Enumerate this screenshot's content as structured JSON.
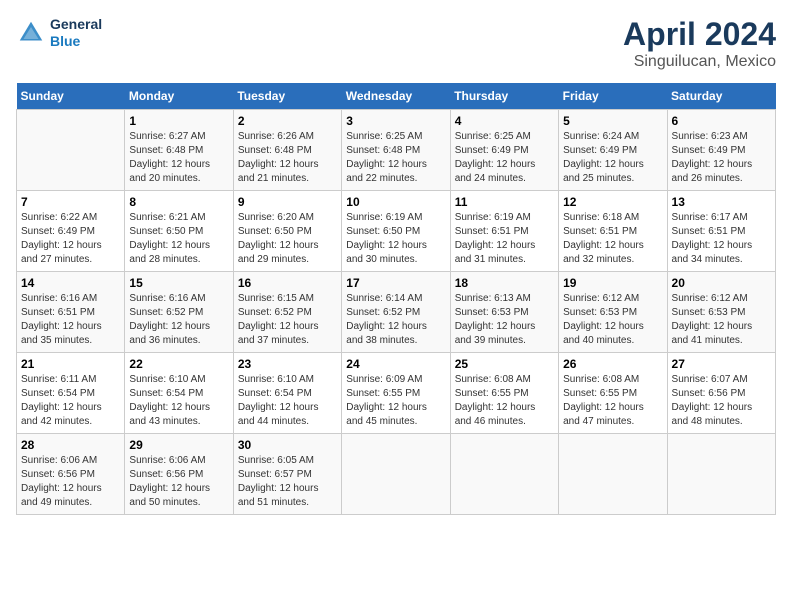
{
  "header": {
    "logo_general": "General",
    "logo_blue": "Blue",
    "title": "April 2024",
    "subtitle": "Singuilucan, Mexico"
  },
  "calendar": {
    "days_of_week": [
      "Sunday",
      "Monday",
      "Tuesday",
      "Wednesday",
      "Thursday",
      "Friday",
      "Saturday"
    ],
    "weeks": [
      [
        {
          "day": "",
          "info": ""
        },
        {
          "day": "1",
          "info": "Sunrise: 6:27 AM\nSunset: 6:48 PM\nDaylight: 12 hours\nand 20 minutes."
        },
        {
          "day": "2",
          "info": "Sunrise: 6:26 AM\nSunset: 6:48 PM\nDaylight: 12 hours\nand 21 minutes."
        },
        {
          "day": "3",
          "info": "Sunrise: 6:25 AM\nSunset: 6:48 PM\nDaylight: 12 hours\nand 22 minutes."
        },
        {
          "day": "4",
          "info": "Sunrise: 6:25 AM\nSunset: 6:49 PM\nDaylight: 12 hours\nand 24 minutes."
        },
        {
          "day": "5",
          "info": "Sunrise: 6:24 AM\nSunset: 6:49 PM\nDaylight: 12 hours\nand 25 minutes."
        },
        {
          "day": "6",
          "info": "Sunrise: 6:23 AM\nSunset: 6:49 PM\nDaylight: 12 hours\nand 26 minutes."
        }
      ],
      [
        {
          "day": "7",
          "info": "Sunrise: 6:22 AM\nSunset: 6:49 PM\nDaylight: 12 hours\nand 27 minutes."
        },
        {
          "day": "8",
          "info": "Sunrise: 6:21 AM\nSunset: 6:50 PM\nDaylight: 12 hours\nand 28 minutes."
        },
        {
          "day": "9",
          "info": "Sunrise: 6:20 AM\nSunset: 6:50 PM\nDaylight: 12 hours\nand 29 minutes."
        },
        {
          "day": "10",
          "info": "Sunrise: 6:19 AM\nSunset: 6:50 PM\nDaylight: 12 hours\nand 30 minutes."
        },
        {
          "day": "11",
          "info": "Sunrise: 6:19 AM\nSunset: 6:51 PM\nDaylight: 12 hours\nand 31 minutes."
        },
        {
          "day": "12",
          "info": "Sunrise: 6:18 AM\nSunset: 6:51 PM\nDaylight: 12 hours\nand 32 minutes."
        },
        {
          "day": "13",
          "info": "Sunrise: 6:17 AM\nSunset: 6:51 PM\nDaylight: 12 hours\nand 34 minutes."
        }
      ],
      [
        {
          "day": "14",
          "info": "Sunrise: 6:16 AM\nSunset: 6:51 PM\nDaylight: 12 hours\nand 35 minutes."
        },
        {
          "day": "15",
          "info": "Sunrise: 6:16 AM\nSunset: 6:52 PM\nDaylight: 12 hours\nand 36 minutes."
        },
        {
          "day": "16",
          "info": "Sunrise: 6:15 AM\nSunset: 6:52 PM\nDaylight: 12 hours\nand 37 minutes."
        },
        {
          "day": "17",
          "info": "Sunrise: 6:14 AM\nSunset: 6:52 PM\nDaylight: 12 hours\nand 38 minutes."
        },
        {
          "day": "18",
          "info": "Sunrise: 6:13 AM\nSunset: 6:53 PM\nDaylight: 12 hours\nand 39 minutes."
        },
        {
          "day": "19",
          "info": "Sunrise: 6:12 AM\nSunset: 6:53 PM\nDaylight: 12 hours\nand 40 minutes."
        },
        {
          "day": "20",
          "info": "Sunrise: 6:12 AM\nSunset: 6:53 PM\nDaylight: 12 hours\nand 41 minutes."
        }
      ],
      [
        {
          "day": "21",
          "info": "Sunrise: 6:11 AM\nSunset: 6:54 PM\nDaylight: 12 hours\nand 42 minutes."
        },
        {
          "day": "22",
          "info": "Sunrise: 6:10 AM\nSunset: 6:54 PM\nDaylight: 12 hours\nand 43 minutes."
        },
        {
          "day": "23",
          "info": "Sunrise: 6:10 AM\nSunset: 6:54 PM\nDaylight: 12 hours\nand 44 minutes."
        },
        {
          "day": "24",
          "info": "Sunrise: 6:09 AM\nSunset: 6:55 PM\nDaylight: 12 hours\nand 45 minutes."
        },
        {
          "day": "25",
          "info": "Sunrise: 6:08 AM\nSunset: 6:55 PM\nDaylight: 12 hours\nand 46 minutes."
        },
        {
          "day": "26",
          "info": "Sunrise: 6:08 AM\nSunset: 6:55 PM\nDaylight: 12 hours\nand 47 minutes."
        },
        {
          "day": "27",
          "info": "Sunrise: 6:07 AM\nSunset: 6:56 PM\nDaylight: 12 hours\nand 48 minutes."
        }
      ],
      [
        {
          "day": "28",
          "info": "Sunrise: 6:06 AM\nSunset: 6:56 PM\nDaylight: 12 hours\nand 49 minutes."
        },
        {
          "day": "29",
          "info": "Sunrise: 6:06 AM\nSunset: 6:56 PM\nDaylight: 12 hours\nand 50 minutes."
        },
        {
          "day": "30",
          "info": "Sunrise: 6:05 AM\nSunset: 6:57 PM\nDaylight: 12 hours\nand 51 minutes."
        },
        {
          "day": "",
          "info": ""
        },
        {
          "day": "",
          "info": ""
        },
        {
          "day": "",
          "info": ""
        },
        {
          "day": "",
          "info": ""
        }
      ]
    ]
  }
}
